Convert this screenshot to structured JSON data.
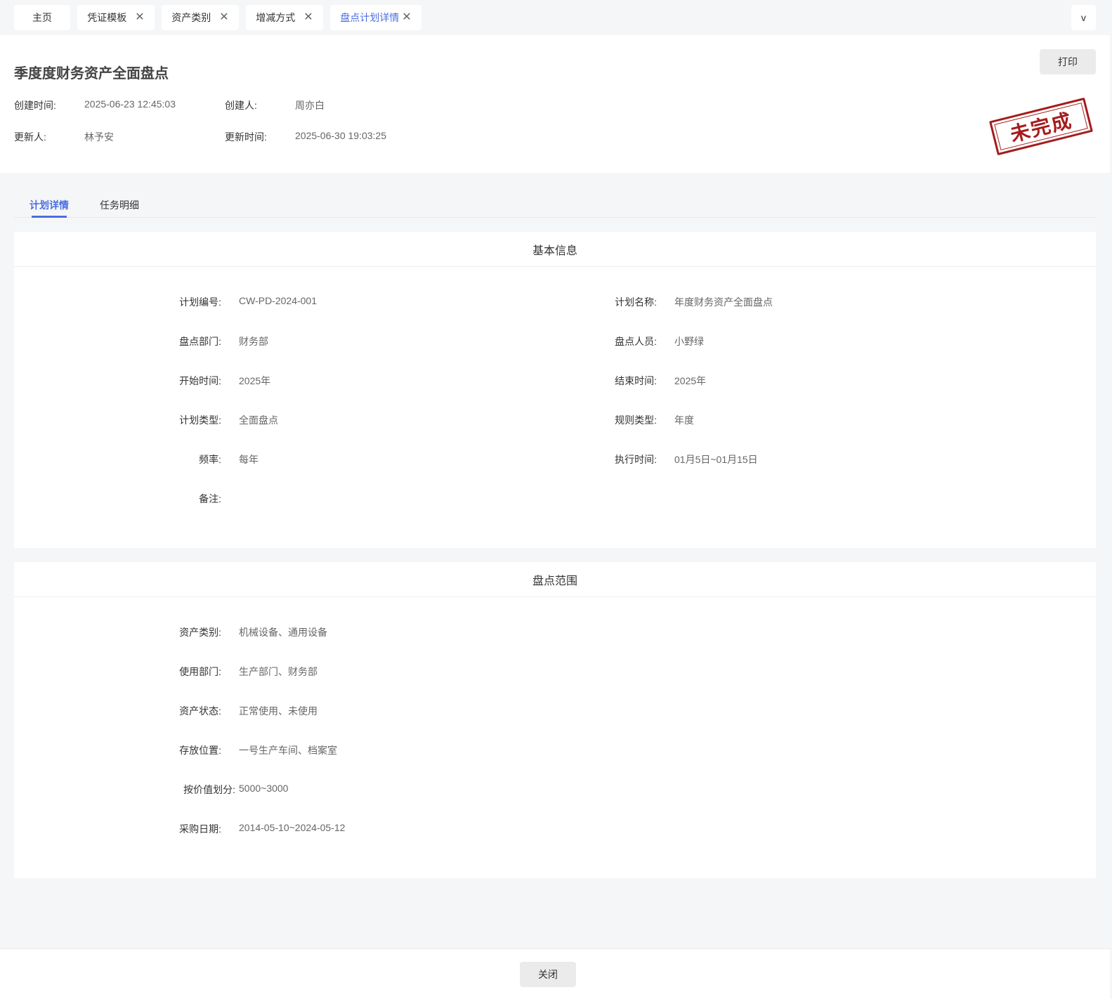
{
  "tabs": [
    {
      "label": "主页",
      "closable": false,
      "active": false
    },
    {
      "label": "凭证模板",
      "closable": true,
      "active": false
    },
    {
      "label": "资产类别",
      "closable": true,
      "active": false
    },
    {
      "label": "增减方式",
      "closable": true,
      "active": false
    },
    {
      "label": "盘点计划详情",
      "closable": true,
      "active": true
    }
  ],
  "tab_dropdown": "v",
  "tab_close_glyph": "✕",
  "header": {
    "title": "季度度财务资产全面盘点",
    "print_label": "打印",
    "stamp_text": "未完成",
    "meta": {
      "created_time_label": "创建时间:",
      "created_time": "2025-06-23 12:45:03",
      "creator_label": "创建人:",
      "creator": "周亦白",
      "updater_label": "更新人:",
      "updater": "林予安",
      "updated_time_label": "更新时间:",
      "updated_time": "2025-06-30 19:03:25"
    }
  },
  "section_tabs": [
    {
      "label": "计划详情",
      "active": true
    },
    {
      "label": "任务明细",
      "active": false
    }
  ],
  "basic_info": {
    "title": "基本信息",
    "plan_no_label": "计划编号:",
    "plan_no": "CW-PD-2024-001",
    "plan_name_label": "计划名称:",
    "plan_name": "年度财务资产全面盘点",
    "dept_label": "盘点部门:",
    "dept": "财务部",
    "staff_label": "盘点人员:",
    "staff": "小野绿",
    "start_label": "开始时间:",
    "start": "2025年",
    "end_label": "结束时间:",
    "end": "2025年",
    "plan_type_label": "计划类型:",
    "plan_type": "全面盘点",
    "rule_type_label": "规则类型:",
    "rule_type": "年度",
    "freq_label": "频率:",
    "freq": "每年",
    "exec_time_label": "执行时间:",
    "exec_time": "01月5日~01月15日",
    "remark_label": "备注:",
    "remark": ""
  },
  "scope": {
    "title": "盘点范围",
    "asset_category_label": "资产类别:",
    "asset_category": "机械设备、通用设备",
    "use_dept_label": "使用部门:",
    "use_dept": "生产部门、财务部",
    "asset_status_label": "资产状态:",
    "asset_status": "正常使用、未使用",
    "location_label": "存放位置:",
    "location": "一号生产车间、档案室",
    "value_range_label": "按价值划分:",
    "value_range": "5000~3000",
    "purchase_date_label": "采购日期:",
    "purchase_date": "2014-05-10~2024-05-12"
  },
  "footer": {
    "close_label": "关闭"
  }
}
